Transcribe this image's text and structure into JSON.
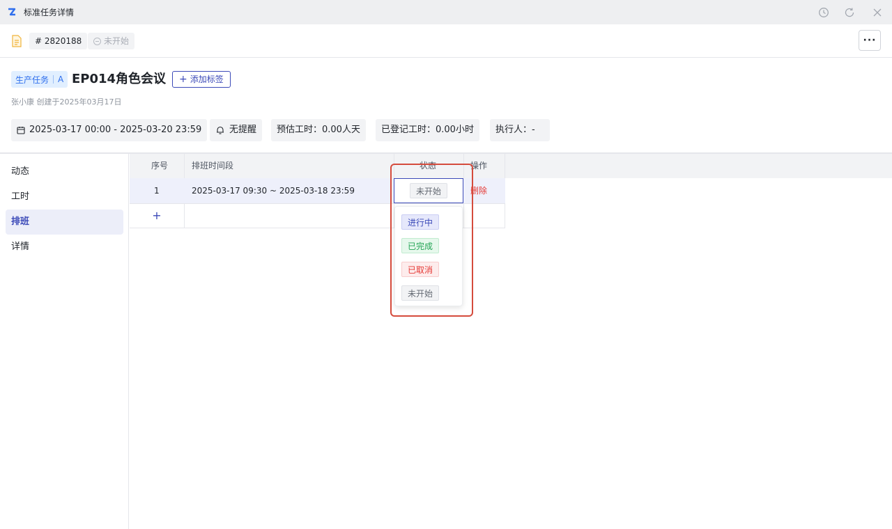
{
  "window": {
    "title": "标准任务详情",
    "icons": [
      "history-icon",
      "refresh-icon",
      "close-icon"
    ]
  },
  "topbar": {
    "task_id": "# 2820188",
    "status": "未开始",
    "more_label": "···"
  },
  "header": {
    "task_type": "生产任务",
    "task_type_suffix": "A",
    "title": "EP014角色会议",
    "add_tag_label": "添加标签",
    "creator_line": "张小康 创建于2025年03月17日",
    "date_range": "2025-03-17 00:00 - 2025-03-20 23:59",
    "reminder": "无提醒",
    "estimated_hours": "预估工时：0.00人天",
    "logged_hours": "已登记工时：0.00小时",
    "assignee": "执行人：-"
  },
  "sidebar": {
    "items": [
      {
        "label": "动态",
        "active": false
      },
      {
        "label": "工时",
        "active": false
      },
      {
        "label": "排班",
        "active": true
      },
      {
        "label": "详情",
        "active": false
      }
    ]
  },
  "schedule_table": {
    "columns": [
      "序号",
      "排班时间段",
      "状态",
      "操作"
    ],
    "rows": [
      {
        "index": "1",
        "time_range": "2025-03-17 09:30 ~ 2025-03-18 23:59",
        "status": "未开始",
        "action": "删除"
      }
    ],
    "add_row_label": "+"
  },
  "status_dropdown": {
    "options": [
      {
        "label": "进行中",
        "color": "#3b49b8"
      },
      {
        "label": "已完成",
        "color": "#23a455"
      },
      {
        "label": "已取消",
        "color": "#e53935"
      },
      {
        "label": "未开始",
        "color": "#646a73"
      }
    ]
  },
  "colors": {
    "accent": "#3b49b8",
    "highlight_box": "#d54b3c",
    "danger": "#e53935"
  }
}
